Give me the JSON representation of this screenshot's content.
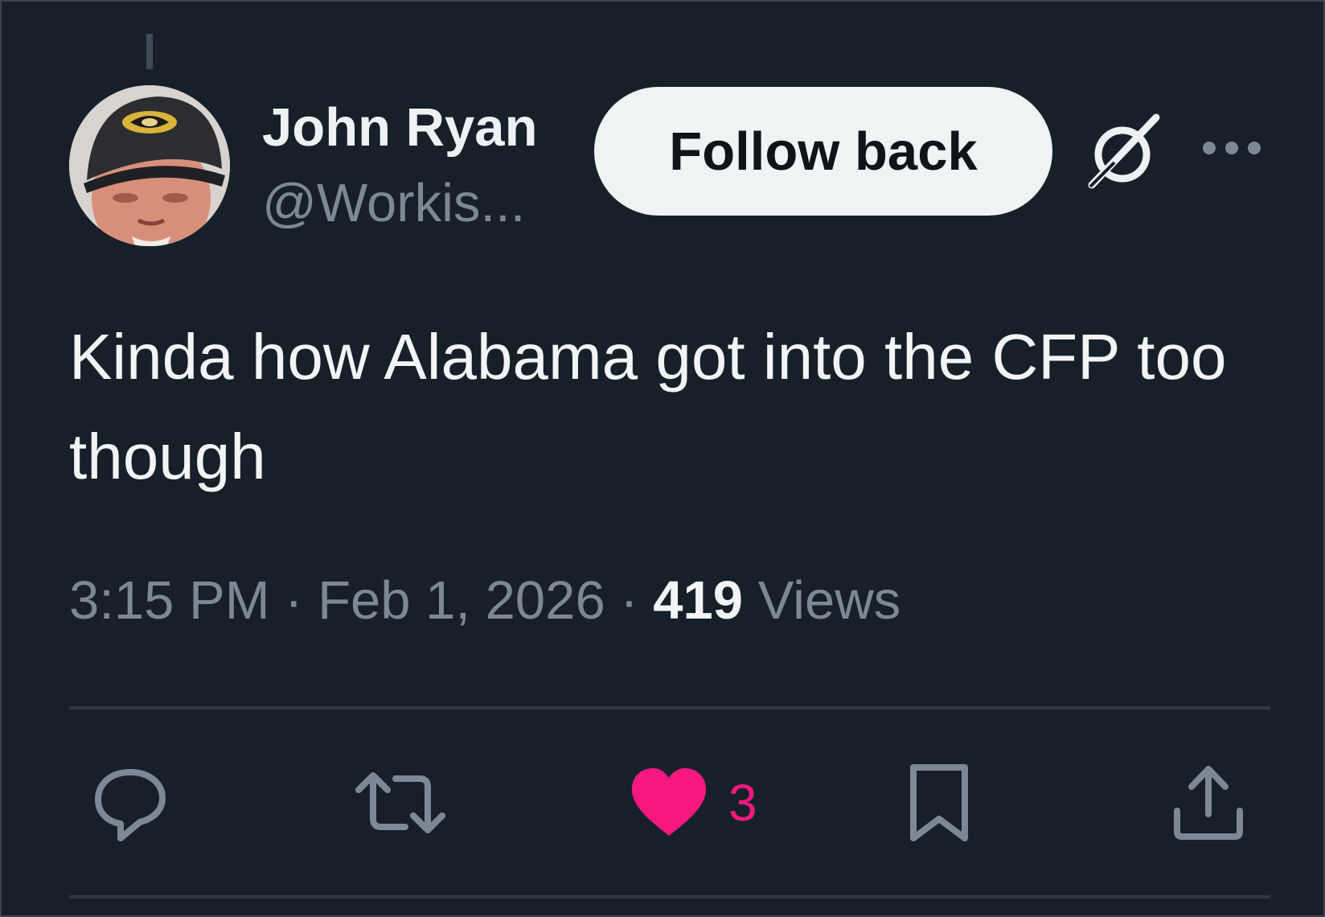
{
  "author": {
    "name": "John Ryan",
    "handle": "@Workis..."
  },
  "follow_button": {
    "label": "Follow back"
  },
  "tweet": {
    "text": "Kinda how Alabama got into the CFP too though",
    "time": "3:15 PM",
    "date": "Feb 1, 2026",
    "separator": "·",
    "views_count": "419",
    "views_label": "Views"
  },
  "actions": {
    "reply_icon": "reply-icon",
    "retweet_icon": "retweet-icon",
    "like_icon": "heart-icon",
    "like_count": "3",
    "bookmark_icon": "bookmark-icon",
    "share_icon": "share-icon"
  },
  "colors": {
    "background": "#172029",
    "like_active": "#f91880",
    "muted_text": "#7d8895",
    "primary_text": "#f2f4f6",
    "button_bg": "#eff3f4"
  }
}
